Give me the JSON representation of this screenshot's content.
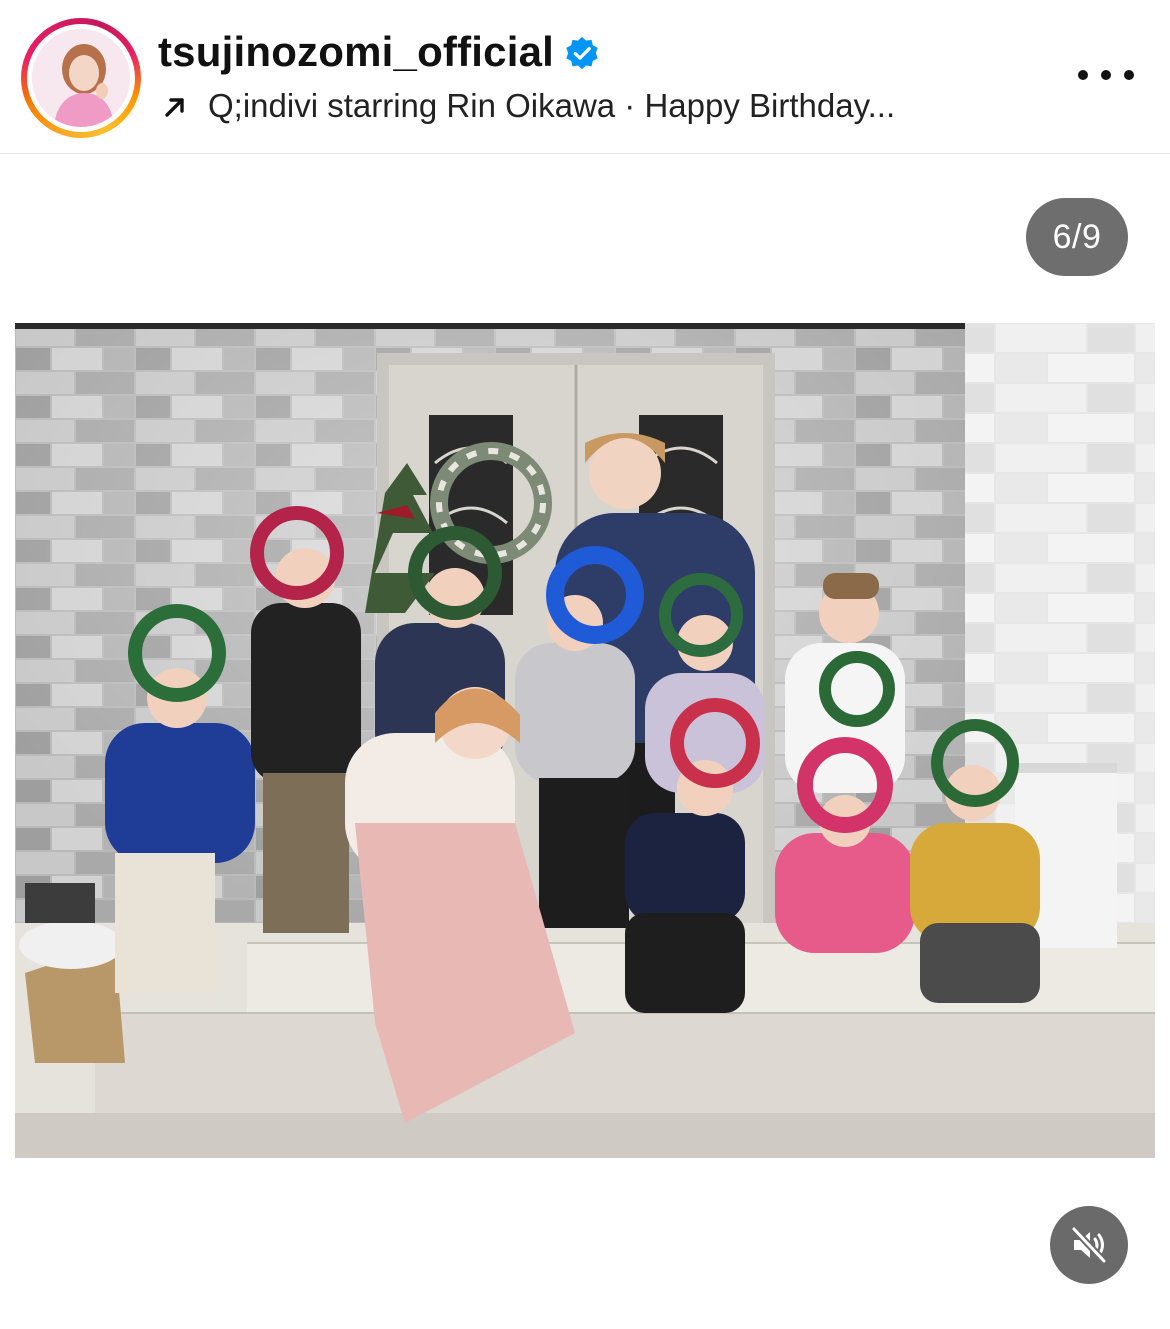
{
  "post": {
    "username": "tsujinozomi_official",
    "verified": true,
    "audio_line": "Q;indivi starring Rin Oikawa · Happy Birthday...",
    "counter": "6/9"
  },
  "icons": {
    "verified": "verified-badge-icon",
    "audio": "arrow-up-right-icon",
    "more": "more-options-icon",
    "mute": "speaker-muted-icon"
  },
  "colors": {
    "verified_blue": "#0095f6",
    "counter_bg": "#6e6e6e",
    "mute_bg": "#6a6a6a"
  }
}
